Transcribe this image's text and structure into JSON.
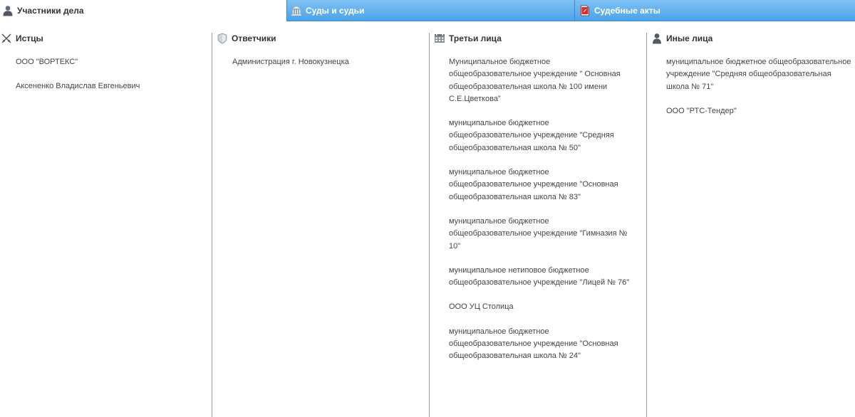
{
  "tabs": [
    {
      "label": "Участники дела",
      "icon": "participant-icon",
      "active": true
    },
    {
      "label": "Суды и судьи",
      "icon": "courthouse-icon",
      "active": false
    },
    {
      "label": "Судебные акты",
      "icon": "pdf-document-icon",
      "active": false
    }
  ],
  "colors": {
    "tab_gradient_top": "#7fc1f3",
    "tab_gradient_bottom": "#4aa3ea",
    "divider": "#9a9a9a",
    "text": "#444444"
  },
  "columns": {
    "plaintiffs": {
      "title": "Истцы",
      "icon": "crossed-swords-icon",
      "items": [
        "ООО \"ВОРТЕКС\"",
        "Аксененко Владислав Евгеньевич"
      ]
    },
    "defendants": {
      "title": "Ответчики",
      "icon": "shield-icon",
      "items": [
        "Администрация г. Новокузнецка"
      ]
    },
    "third_parties": {
      "title": "Третьи лица",
      "icon": "group-icon",
      "items": [
        "Муниципальное бюджетное общеобразовательное учреждение \" Основная общеобразовательная школа № 100 имени С.Е.Цветкова\"",
        "муниципальное бюджетное общеобразовательное учреждение \"Средняя общеобразовательная школа № 50\"",
        "муниципальное бюджетное общеобразовательное учреждение \"Основная общеобразовательная школа № 83\"",
        "муниципальное бюджетное общеобразовательное учреждение \"Гимназия № 10\"",
        "муниципальное нетиповое бюджетное общеобразовательное учреждение \"Лицей № 76\"",
        "ООО УЦ Столица",
        "муниципальное бюджетное общеобразовательное учреждение \"Основная общеобразовательная школа № 24\""
      ]
    },
    "others": {
      "title": "Иные лица",
      "icon": "person-icon",
      "items": [
        "муниципальное бюджетное общеобразовательное учреждение \"Средняя общеобразовательная школа № 71\"",
        "ООО \"РТС-Тендер\""
      ]
    }
  }
}
